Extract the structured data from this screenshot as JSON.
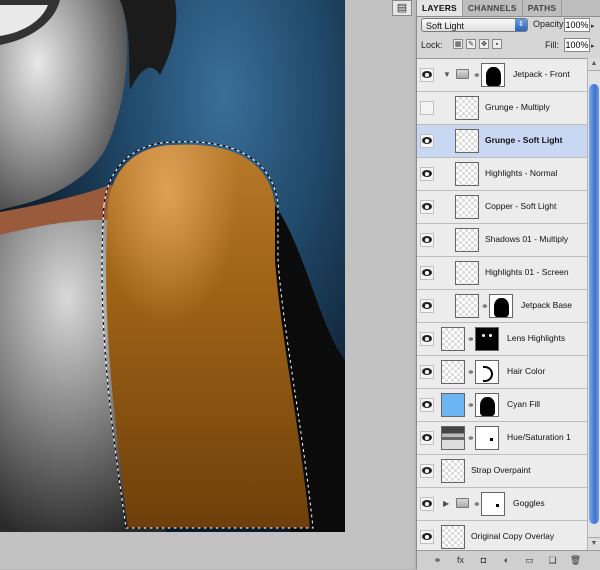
{
  "panel": {
    "tabs": [
      {
        "label": "LAYERS",
        "active": true
      },
      {
        "label": "CHANNELS",
        "active": false
      },
      {
        "label": "PATHS",
        "active": false
      }
    ],
    "blend_mode": "Soft Light",
    "opacity_label": "Opacity:",
    "opacity_value": "100%",
    "lock_label": "Lock:",
    "fill_label": "Fill:",
    "fill_value": "100%"
  },
  "layers": [
    {
      "name": "Jetpack - Front",
      "visible": true,
      "type": "group",
      "expanded": true,
      "mask": "silhouette",
      "selected": false
    },
    {
      "name": "Grunge - Multiply",
      "visible": false,
      "type": "pixel",
      "indent": true,
      "selected": false
    },
    {
      "name": "Grunge - Soft Light",
      "visible": true,
      "type": "pixel",
      "indent": true,
      "selected": true
    },
    {
      "name": "Highlights - Normal",
      "visible": true,
      "type": "pixel",
      "indent": true,
      "selected": false
    },
    {
      "name": "Copper - Soft Light",
      "visible": true,
      "type": "pixel",
      "indent": true,
      "selected": false
    },
    {
      "name": "Shadows 01 - Multiply",
      "visible": true,
      "type": "pixel",
      "indent": true,
      "selected": false
    },
    {
      "name": "Highlights 01 - Screen",
      "visible": true,
      "type": "pixel",
      "indent": true,
      "selected": false
    },
    {
      "name": "Jetpack Base",
      "visible": true,
      "type": "pixel",
      "indent": true,
      "mask": "silhouette",
      "selected": false
    },
    {
      "name": "Lens Highlights",
      "visible": true,
      "type": "pixel",
      "mask": "dots",
      "selected": false
    },
    {
      "name": "Hair Color",
      "visible": true,
      "type": "pixel",
      "mask": "stroke",
      "selected": false
    },
    {
      "name": "Cyan Fill",
      "visible": true,
      "type": "fill",
      "mask": "silhouette",
      "selected": false
    },
    {
      "name": "Hue/Saturation 1",
      "visible": true,
      "type": "adjustment",
      "mask": "speck",
      "selected": false
    },
    {
      "name": "Strap Overpaint",
      "visible": true,
      "type": "pixel",
      "selected": false
    },
    {
      "name": "Goggles",
      "visible": true,
      "type": "group",
      "expanded": false,
      "mask": "speck",
      "selected": false
    },
    {
      "name": "Original Copy Overlay",
      "visible": true,
      "type": "pixel",
      "selected": false
    }
  ],
  "footer_icons": [
    "link-layers-icon",
    "fx-icon",
    "add-mask-icon",
    "adjustment-layer-icon",
    "new-group-icon",
    "new-layer-icon",
    "trash-icon"
  ],
  "footer_glyphs": [
    "⚭",
    "fx",
    "◘",
    "◐",
    "▭",
    "❏",
    "🗑"
  ]
}
